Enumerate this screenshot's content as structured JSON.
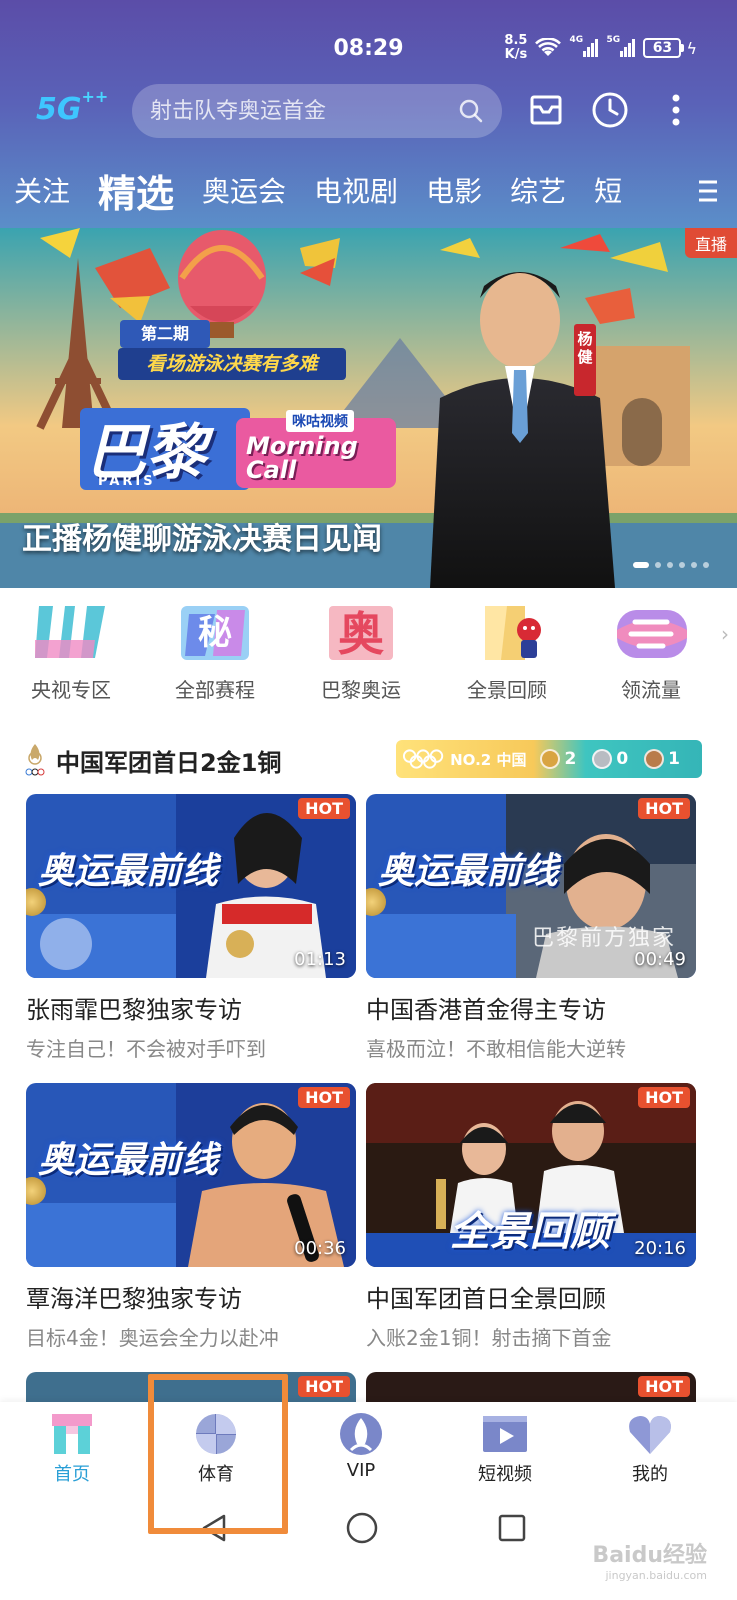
{
  "status_bar": {
    "time": "08:29",
    "net_speed_value": "8.5",
    "net_speed_unit": "K/s",
    "sig1": "4G",
    "sig2": "5G",
    "battery": "63"
  },
  "header": {
    "logo": "5G",
    "logo_sup": "++",
    "search_placeholder": "射击队夺奥运首金",
    "tabs": [
      "关注",
      "精选",
      "奥运会",
      "电视剧",
      "电影",
      "综艺",
      "短"
    ],
    "active_tab": "精选"
  },
  "banner": {
    "badge": "直播",
    "caption": "正播杨健聊游泳决赛日见闻",
    "poster_episode": "第二期",
    "poster_subtitle": "看场游泳决赛有多难",
    "poster_title": "巴黎",
    "poster_paris": "PARIS",
    "poster_brand": "咪咕视频",
    "poster_show": "Morning Call",
    "host_name": "杨健",
    "slide_count": 6,
    "active_slide": 0
  },
  "quick_entries": [
    {
      "label": "央视专区",
      "icon": "cctv-icon"
    },
    {
      "label": "全部赛程",
      "icon": "schedule-icon"
    },
    {
      "label": "巴黎奥运",
      "icon": "paris-olympics-icon"
    },
    {
      "label": "全景回顾",
      "icon": "review-icon"
    },
    {
      "label": "领流量",
      "icon": "data-gift-icon"
    }
  ],
  "section": {
    "title": "中国军团首日2金1铜",
    "rank": "NO.2 中国",
    "gold": "2",
    "silver": "0",
    "bronze": "1"
  },
  "videos": [
    {
      "title": "张雨霏巴黎独家专访",
      "subtitle": "专注自己！不会被对手吓到",
      "duration": "01:13",
      "badge": "HOT",
      "overlay": "奥运最前线"
    },
    {
      "title": "中国香港首金得主专访",
      "subtitle": "喜极而泣！不敢相信能大逆转",
      "duration": "00:49",
      "badge": "HOT",
      "overlay": "奥运最前线",
      "overlay2": "巴黎前方独家"
    },
    {
      "title": "覃海洋巴黎独家专访",
      "subtitle": "目标4金！奥运会全力以赴冲",
      "duration": "00:36",
      "badge": "HOT",
      "overlay": "奥运最前线"
    },
    {
      "title": "中国军团首日全景回顾",
      "subtitle": "入账2金1铜！射击摘下首金",
      "duration": "20:16",
      "badge": "HOT",
      "overlay": "全景回顾"
    },
    {
      "badge": "HOT"
    },
    {
      "badge": "HOT"
    }
  ],
  "bottom_nav": [
    {
      "label": "首页",
      "icon": "home-icon",
      "active": true
    },
    {
      "label": "体育",
      "icon": "sports-icon",
      "active": false
    },
    {
      "label": "VIP",
      "icon": "vip-icon",
      "active": false
    },
    {
      "label": "短视频",
      "icon": "short-video-icon",
      "active": false
    },
    {
      "label": "我的",
      "icon": "profile-icon",
      "active": false
    }
  ],
  "watermark": {
    "text": "Baidu经验",
    "sub": "jingyan.baidu.com"
  },
  "colors": {
    "header_top": "#5b4da8",
    "header_bottom": "#5b8fc9",
    "active_nav": "#2a9fd6",
    "hot": "#e8512f",
    "highlight": "#f08b3a"
  }
}
